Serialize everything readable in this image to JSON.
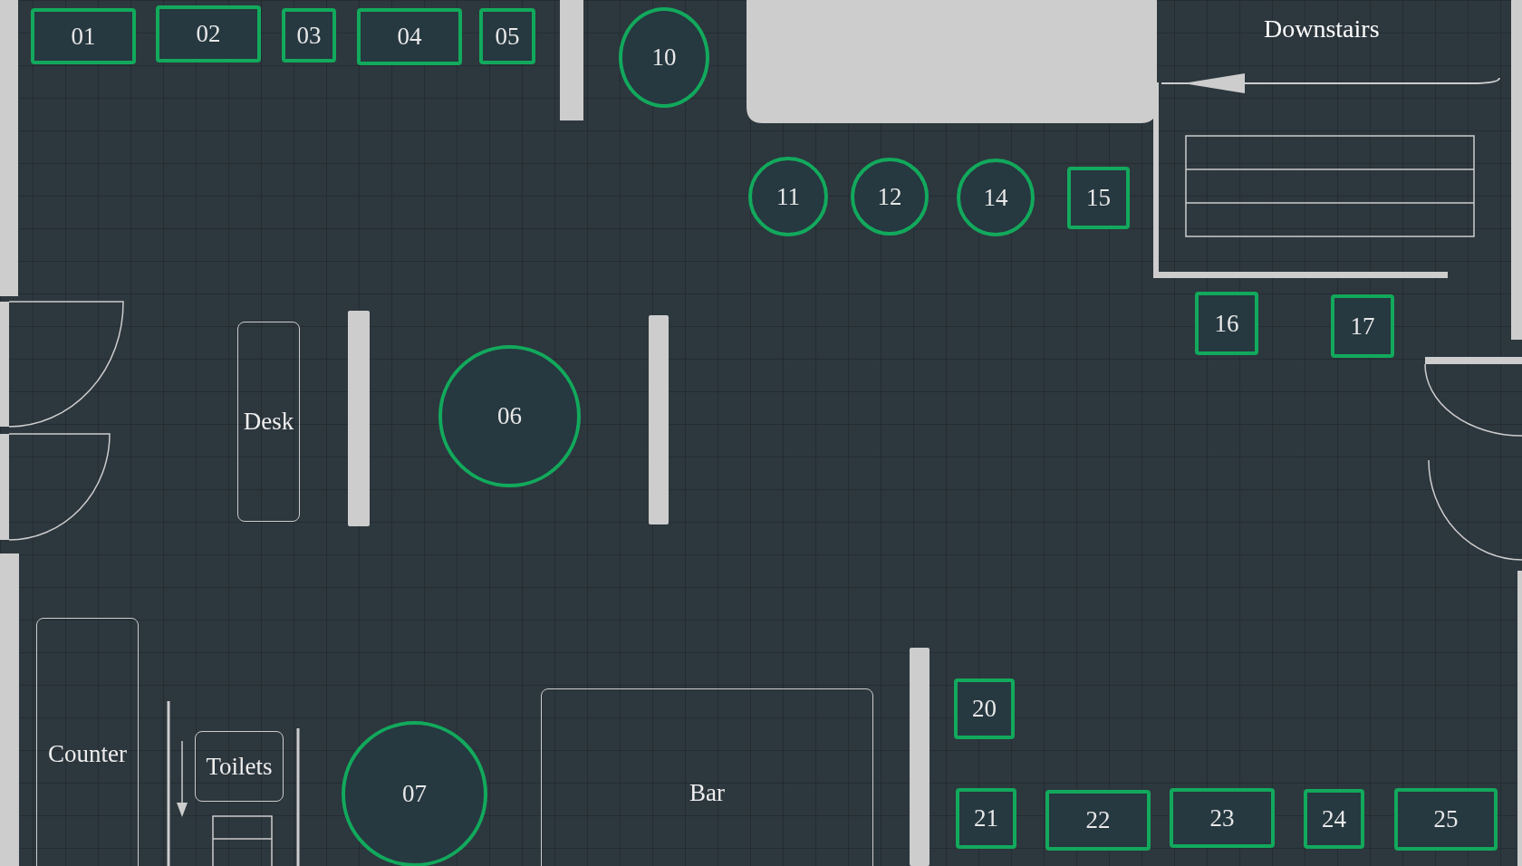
{
  "tables": [
    {
      "label": "01",
      "kind": "rect"
    },
    {
      "label": "02",
      "kind": "rect"
    },
    {
      "label": "03",
      "kind": "rect"
    },
    {
      "label": "04",
      "kind": "rect"
    },
    {
      "label": "05",
      "kind": "rect"
    },
    {
      "label": "10",
      "kind": "round"
    },
    {
      "label": "11",
      "kind": "round"
    },
    {
      "label": "12",
      "kind": "round"
    },
    {
      "label": "14",
      "kind": "round"
    },
    {
      "label": "15",
      "kind": "rect"
    },
    {
      "label": "16",
      "kind": "rect"
    },
    {
      "label": "17",
      "kind": "rect"
    },
    {
      "label": "06",
      "kind": "round"
    },
    {
      "label": "07",
      "kind": "round"
    },
    {
      "label": "20",
      "kind": "rect"
    },
    {
      "label": "21",
      "kind": "rect"
    },
    {
      "label": "22",
      "kind": "rect"
    },
    {
      "label": "23",
      "kind": "rect"
    },
    {
      "label": "24",
      "kind": "rect"
    },
    {
      "label": "25",
      "kind": "rect"
    }
  ],
  "areas": [
    {
      "label": "Desk"
    },
    {
      "label": "Counter"
    },
    {
      "label": "Toilets"
    },
    {
      "label": "Bar"
    }
  ],
  "stairs": {
    "label": "Downstairs"
  }
}
